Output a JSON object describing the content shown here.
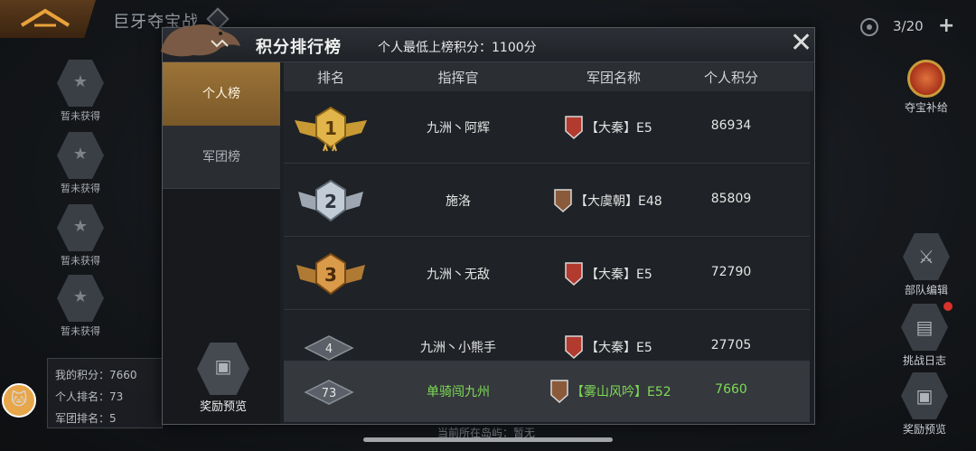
{
  "topbar": {
    "title": "巨牙夺宝战",
    "counter": "3/20"
  },
  "left_slots": [
    {
      "label": "暂未获得"
    },
    {
      "label": "暂未获得"
    },
    {
      "label": "暂未获得"
    },
    {
      "label": "暂未获得"
    }
  ],
  "my_stats": {
    "score": "我的积分：7660",
    "personal_rank": "个人排名：73",
    "guild_rank": "军团排名：5"
  },
  "right_buttons": {
    "supply": "夺宝补给",
    "troop_edit": "部队编辑",
    "battle_log": "挑战日志",
    "reward_preview": "奖励预览"
  },
  "bottom_hint": "当前所在岛屿：暂无",
  "modal": {
    "title": "积分排行榜",
    "subtitle": "个人最低上榜积分：1100分",
    "tabs": [
      {
        "label": "个人榜"
      },
      {
        "label": "军团榜"
      }
    ],
    "reward_preview_label": "奖励预览",
    "columns": {
      "rank": "排名",
      "commander": "指挥官",
      "guild": "军团名称",
      "score": "个人积分"
    },
    "rows": [
      {
        "rank": "1",
        "commander": "九洲丶阿辉",
        "guild": "【大秦】E5",
        "score": "86934"
      },
      {
        "rank": "2",
        "commander": "施洛",
        "guild": "【大虞朝】E48",
        "score": "85809"
      },
      {
        "rank": "3",
        "commander": "九洲丶无敌",
        "guild": "【大秦】E5",
        "score": "72790"
      },
      {
        "rank": "4",
        "commander": "九洲丶小熊手",
        "guild": "【大秦】E5",
        "score": "27705"
      }
    ],
    "me": {
      "rank": "73",
      "commander": "单骑闯九州",
      "guild": "【雾山风吟】E52",
      "score": "7660"
    }
  },
  "colors": {
    "gold": "#d4a23a",
    "silver": "#b9c2cc",
    "bronze": "#c98a3c",
    "self_green": "#7ddc55",
    "tab_active": "#9c7438"
  }
}
